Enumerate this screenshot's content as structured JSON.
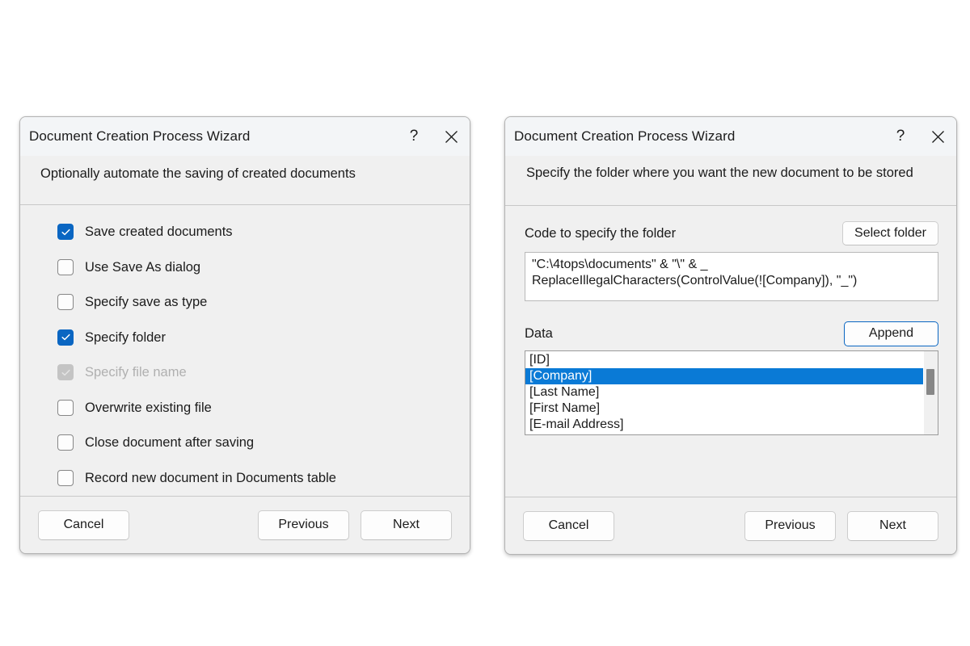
{
  "left_dialog": {
    "title": "Document Creation Process Wizard",
    "subtitle": "Optionally automate the saving of created documents",
    "help_icon": "question-mark-icon",
    "close_icon": "close-icon",
    "checkboxes": [
      {
        "label": "Save created documents",
        "checked": true,
        "disabled": false
      },
      {
        "label": "Use Save As dialog",
        "checked": false,
        "disabled": false
      },
      {
        "label": "Specify save as type",
        "checked": false,
        "disabled": false
      },
      {
        "label": "Specify folder",
        "checked": true,
        "disabled": false
      },
      {
        "label": "Specify file name",
        "checked": true,
        "disabled": true
      },
      {
        "label": "Overwrite existing file",
        "checked": false,
        "disabled": false
      },
      {
        "label": "Close document after saving",
        "checked": false,
        "disabled": false
      },
      {
        "label": "Record new document in Documents table",
        "checked": false,
        "disabled": false
      }
    ],
    "footer": {
      "cancel_label": "Cancel",
      "previous_label": "Previous",
      "next_label": "Next"
    }
  },
  "right_dialog": {
    "title": "Document Creation Process Wizard",
    "subtitle": "Specify the folder where you want the new document to be stored",
    "help_icon": "question-mark-icon",
    "close_icon": "close-icon",
    "code_section": {
      "label": "Code to specify the folder",
      "select_folder_label": "Select folder",
      "code_line_1": "\"C:\\4tops\\documents\" & \"\\\" & _",
      "code_line_2": "ReplaceIllegalCharacters(ControlValue(![Company]), \"_\")"
    },
    "data_section": {
      "label": "Data",
      "append_label": "Append",
      "items": [
        {
          "label": "[ID]",
          "selected": false
        },
        {
          "label": "[Company]",
          "selected": true
        },
        {
          "label": "[Last Name]",
          "selected": false
        },
        {
          "label": "[First Name]",
          "selected": false
        },
        {
          "label": "[E-mail Address]",
          "selected": false
        }
      ]
    },
    "footer": {
      "cancel_label": "Cancel",
      "previous_label": "Previous",
      "next_label": "Next"
    }
  },
  "colors": {
    "accent_blue": "#0a66c2",
    "selection_blue": "#0a7ad6",
    "dialog_bg": "#f0f0f0",
    "titlebar_bg": "#f3f5f7",
    "disabled_gray": "#c4c4c4"
  }
}
